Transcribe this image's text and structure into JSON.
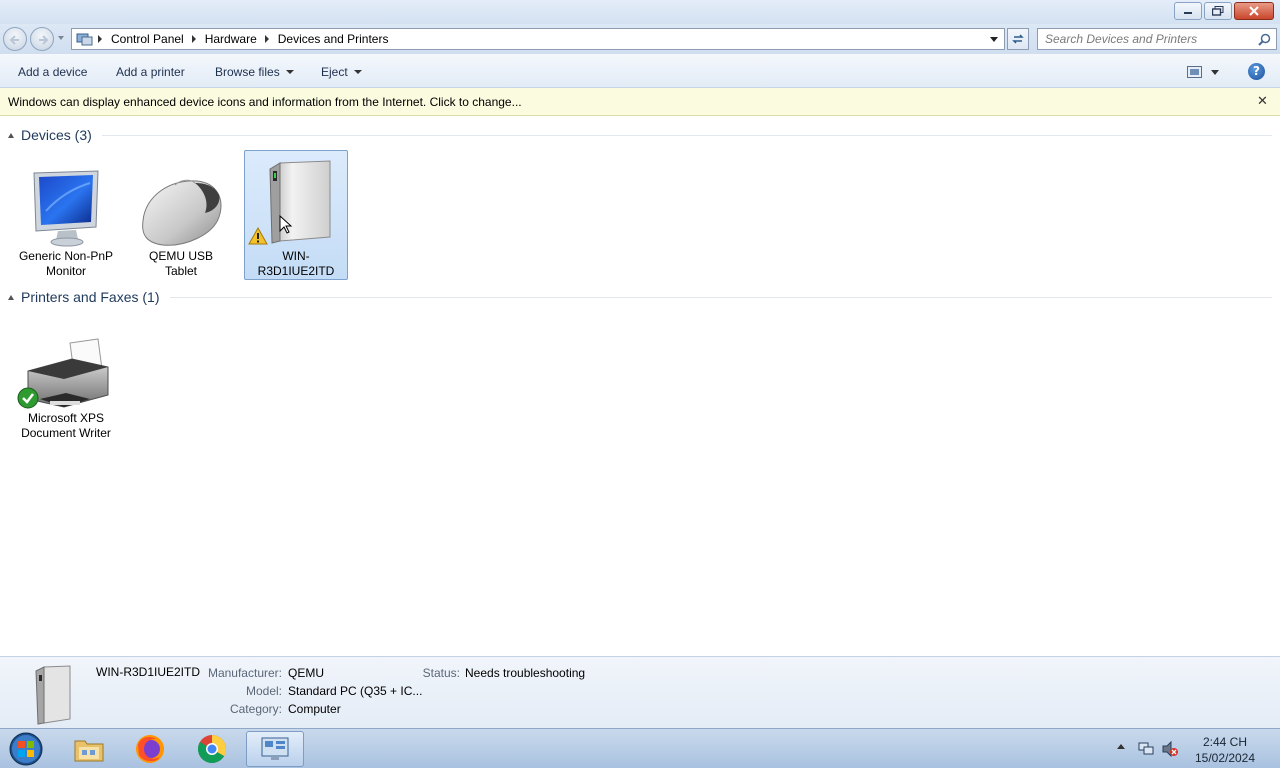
{
  "window": {
    "controls": {
      "minimize": "minimize",
      "maximize": "restore",
      "close": "close"
    }
  },
  "address": {
    "breadcrumbs": [
      "Control Panel",
      "Hardware",
      "Devices and Printers"
    ],
    "search_placeholder": "Search Devices and Printers"
  },
  "toolbar": {
    "add_device": "Add a device",
    "add_printer": "Add a printer",
    "browse_files": "Browse files",
    "eject": "Eject"
  },
  "infobar": {
    "message": "Windows can display enhanced device icons and information from the Internet. Click to change..."
  },
  "groups": {
    "devices": {
      "title": "Devices (3)",
      "items": [
        {
          "label": "Generic Non-PnP Monitor",
          "icon": "monitor-icon"
        },
        {
          "label": "QEMU USB Tablet",
          "icon": "mouse-icon"
        },
        {
          "label": "WIN-R3D1IUE2ITD",
          "icon": "computer-tower-icon",
          "selected": true,
          "warning": true
        }
      ]
    },
    "printers": {
      "title": "Printers and Faxes (1)",
      "items": [
        {
          "label": "Microsoft XPS Document Writer",
          "icon": "printer-icon",
          "default": true
        }
      ]
    }
  },
  "details": {
    "name": "WIN-R3D1IUE2ITD",
    "manufacturer_label": "Manufacturer:",
    "manufacturer": "QEMU",
    "model_label": "Model:",
    "model": "Standard PC (Q35 + IC...",
    "category_label": "Category:",
    "category": "Computer",
    "status_label": "Status:",
    "status": "Needs troubleshooting"
  },
  "taskbar": {
    "apps": [
      "start-orb-icon",
      "file-explorer-icon",
      "firefox-icon",
      "chrome-icon",
      "devices-printers-icon"
    ],
    "time": "2:44 CH",
    "date": "15/02/2024"
  },
  "colors": {
    "accent": "#1e395b",
    "selection": "#c4dcf6",
    "infobar": "#fbfbe0",
    "close_button": "#c9462c"
  }
}
